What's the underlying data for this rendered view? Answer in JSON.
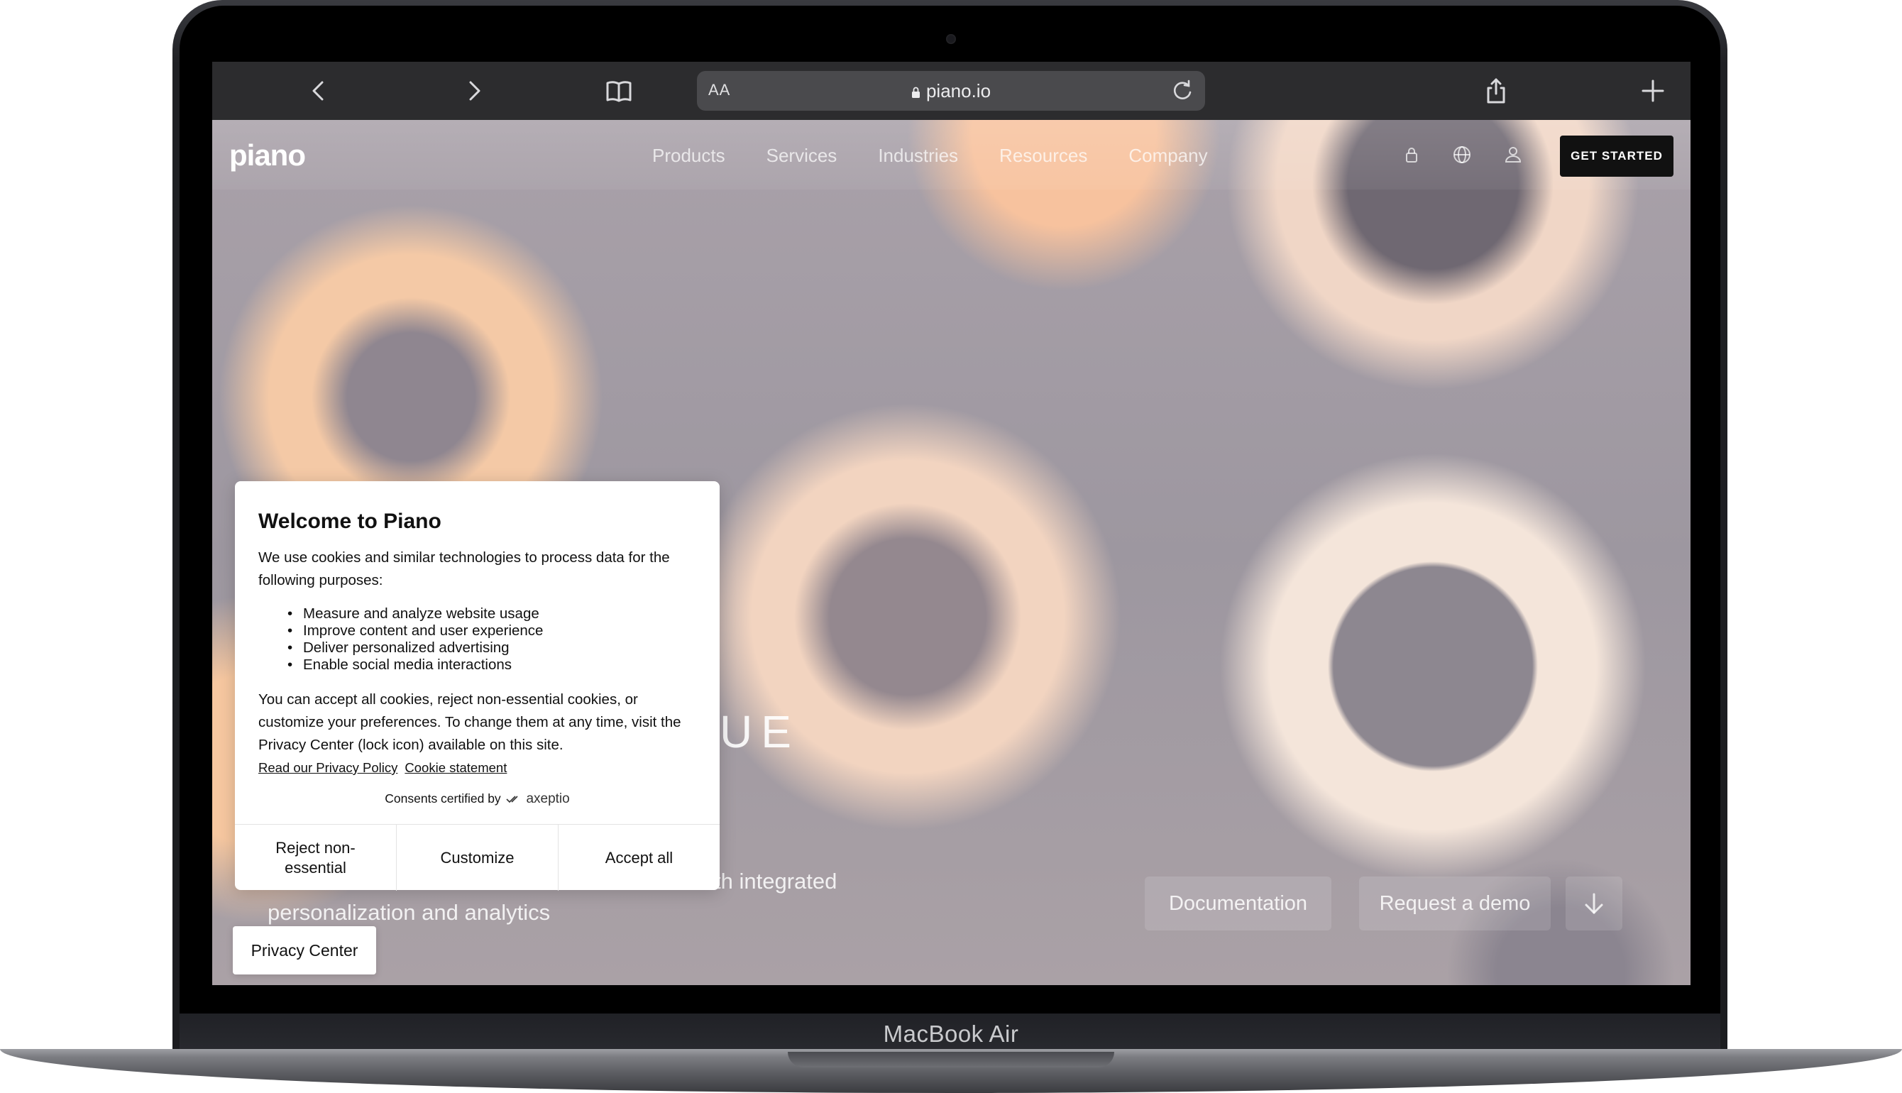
{
  "device": {
    "brand_label": "MacBook Air"
  },
  "browser": {
    "reader_label": "AA",
    "url": "piano.io",
    "icons": [
      "back-icon",
      "forward-icon",
      "bookmarks-icon",
      "lock-icon",
      "reload-icon",
      "share-icon",
      "new-tab-icon",
      "tabs-icon"
    ]
  },
  "site": {
    "logo": "piano",
    "nav": [
      "Products",
      "Services",
      "Industries",
      "Resources",
      "Company"
    ],
    "nav_icons": [
      "privacy-lock-icon",
      "globe-icon",
      "user-icon"
    ],
    "cta": "GET STARTED",
    "hero": {
      "heading_fragment": "UE",
      "subtitle_fragment_right": "th integrated",
      "subtitle_fragment_left": "personalization and analytics",
      "buttons": [
        "Documentation",
        "Request a demo"
      ],
      "scroll_icon": "arrow-down-icon"
    }
  },
  "cookie_banner": {
    "title": "Welcome to Piano",
    "intro": "We use cookies and similar technologies to process data for the following purposes:",
    "purposes": [
      "Measure and analyze website usage",
      "Improve content and user experience",
      "Deliver personalized advertising",
      "Enable social media interactions"
    ],
    "body": "You can accept all cookies, reject non-essential cookies, or customize your preferences. To change them at any time, visit the Privacy Center (lock icon) available on this site.",
    "links": [
      "Read our Privacy Policy",
      "Cookie statement"
    ],
    "certified_by": "Consents certified by",
    "certifier": "axeptio",
    "actions": {
      "reject": "Reject non-essential",
      "customize": "Customize",
      "accept": "Accept all"
    }
  },
  "privacy_center": "Privacy Center"
}
